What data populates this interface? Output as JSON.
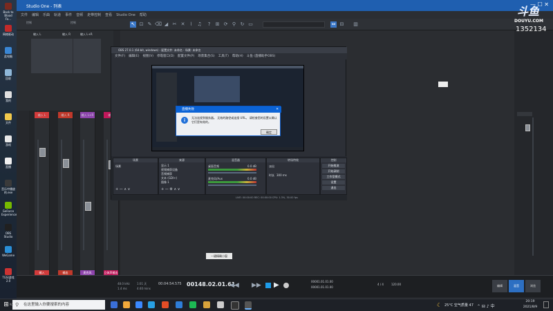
{
  "desktop": {
    "icons": [
      {
        "label": "Back to Blood Fa...",
        "color": "#7a2a20"
      },
      {
        "label": "网络驱动",
        "color": "#c02a2a"
      },
      {
        "label": "此电脑",
        "color": "#3a86d4"
      },
      {
        "label": "回收",
        "color": "#8fb7d8"
      },
      {
        "label": "我的",
        "color": "#e0e0e0"
      },
      {
        "label": "文件",
        "color": "#f2c94c"
      },
      {
        "label": "游戏",
        "color": "#e8e8e8"
      },
      {
        "label": "直播",
        "color": "#f0f0f0"
      },
      {
        "label": "音乐中播放的.exe",
        "color": "#3a3a3a"
      },
      {
        "label": "GeForce Experience",
        "color": "#76b900"
      },
      {
        "label": "OBS Studio",
        "color": "#202020"
      },
      {
        "label": "WeGame",
        "color": "#2a8fd8"
      },
      {
        "label": "TGSI游戏2.0",
        "color": "#c33"
      }
    ]
  },
  "studio": {
    "title": "Studio One - 列表",
    "menu": [
      "文件",
      "编辑",
      "乐曲",
      "轨道",
      "事件",
      "音频",
      "走带控制",
      "查看",
      "Studio One",
      "帮助"
    ],
    "toolbar_labels": [
      "控制",
      "控制"
    ],
    "tracks": [
      "输入 L",
      "输入 R",
      "输入 L+R"
    ],
    "mixer_channels": [
      {
        "name": "输入 L",
        "label": "输入",
        "color": "#d23b3b"
      },
      {
        "name": "输入 R",
        "label": "输出",
        "color": "#c0392b"
      },
      {
        "name": "输入 L+R",
        "label": "麦克风",
        "color": "#8e44ad"
      },
      {
        "name": "输出",
        "label": "立体声输出",
        "color": "#c2185b"
      }
    ],
    "tooltip": "一键精确小窗",
    "transport": {
      "samplerate": "48.0 kHz",
      "latency": "1.4 ms",
      "time1": "1:01 天",
      "time2": "4:40 mins",
      "timecode": "00:04:54.575",
      "bars": "00148.02.01.61",
      "loop_l": "00001.01.01.00",
      "loop_r": "00001.01.01.00",
      "signature": "4 / 4",
      "tempo": "120.00",
      "btn_edit": "编辑",
      "btn_mix": "混音",
      "btn_browse": "浏览"
    }
  },
  "watermark": {
    "logo": "斗鱼",
    "site": "DOUYU.COM",
    "room": "1352134"
  },
  "obs": {
    "title": "OBS 27.0.1 (64-bit, windows) - 配置文件: 未命名 - 场景: 未命名",
    "menu": [
      "文件(F)",
      "编辑(E)",
      "视图(V)",
      "停靠窗口(D)",
      "配置文件(P)",
      "场景集合(S)",
      "工具(T)",
      "帮助(H)",
      "斗鱼 (直播助手OBS)"
    ],
    "panels": {
      "scenes": "场景",
      "sources": "来源",
      "mixer": "混音器",
      "transitions": "转场特效",
      "controls": "控制"
    },
    "scene_items": [
      "场景"
    ],
    "source_items": [
      "显示 1",
      "视频捕获设备",
      "音频捕获",
      "文本 (GDI+)",
      "图像 1"
    ],
    "mixer_items": [
      {
        "name": "桌面音频",
        "db": "0.0 dB"
      },
      {
        "name": "麦克风/Aux",
        "db": "0.0 dB"
      }
    ],
    "transition": {
      "name": "淡出",
      "duration_label": "时长",
      "duration": "300 ms"
    },
    "control_buttons": [
      "开始推流",
      "开始录制",
      "工作室模式",
      "设置",
      "退出"
    ],
    "status": "LIVE: 00:00:00   REC: 00:00:00   CPU: 1.3%, 30.00 fps"
  },
  "dialog": {
    "title": "直播失败",
    "message": "无法连接到服务器。 无效的路径或连接 URL。 请检查您的设置以确认它们是有效的。",
    "button": "确定"
  },
  "taskbar": {
    "search_placeholder": "在这里输入你要搜索的内容",
    "weather": "25°C 空气质量 47",
    "clock_time": "20:19",
    "clock_date": "2021/8/9",
    "side_label": "Ko",
    "app_colors": [
      "#3a6fd8",
      "#f2a93b",
      "#3b88ff",
      "#28a0e4",
      "#e44d26",
      "#2e7dd8",
      "#1db954",
      "#d8a33b",
      "#cccccc",
      "#333333"
    ]
  }
}
